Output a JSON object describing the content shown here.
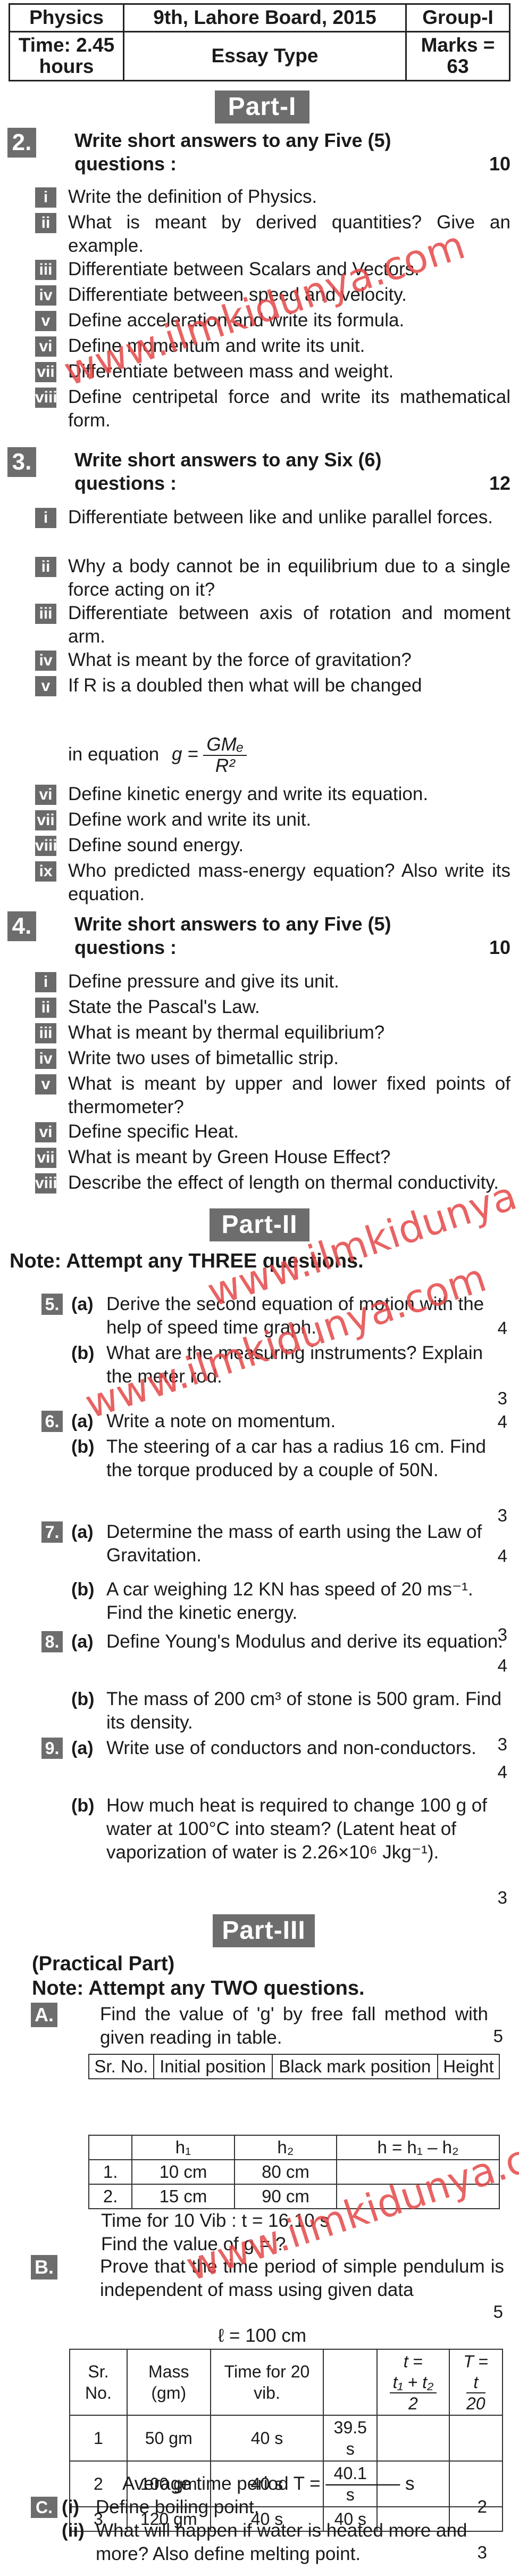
{
  "header": {
    "subject": "Physics",
    "board": "9th, Lahore Board, 2015",
    "group": "Group-I",
    "time": "Time: 2.45 hours",
    "type": "Essay Type",
    "marks": "Marks = 63"
  },
  "part1": {
    "title": "Part-I",
    "q2": {
      "num": "2.",
      "line1": "Write short answers to any Five (5)",
      "line2": "questions :",
      "marks": "10",
      "items": [
        {
          "tag": "i",
          "text": "Write the definition of Physics."
        },
        {
          "tag": "ii",
          "text": "What is meant by derived quantities? Give an example."
        },
        {
          "tag": "iii",
          "text": "Differentiate between Scalars and Vectors."
        },
        {
          "tag": "iv",
          "text": "Differentiate between speed and velocity."
        },
        {
          "tag": "v",
          "text": "Define acceleration and write its formula."
        },
        {
          "tag": "vi",
          "text": "Define momentum and write its unit."
        },
        {
          "tag": "vii",
          "text": "Differentiate between mass and weight."
        },
        {
          "tag": "viii",
          "text": "Define centripetal force and write its mathematical form."
        }
      ]
    },
    "q3": {
      "num": "3.",
      "line1": "Write short answers to any Six (6)",
      "line2": "questions :",
      "marks": "12",
      "items": [
        {
          "tag": "i",
          "text": "Differentiate between like and unlike parallel forces."
        },
        {
          "tag": "ii",
          "text": "Why a body cannot be in equilibrium due to a single force acting on it?"
        },
        {
          "tag": "iii",
          "text": "Differentiate between axis of rotation and moment arm."
        },
        {
          "tag": "iv",
          "text": "What is meant by the force of gravitation?"
        },
        {
          "tag": "v",
          "text": "If R is a doubled then what will be changed"
        },
        {
          "tag": "vi",
          "text": "Define kinetic energy and write its equation."
        },
        {
          "tag": "vii",
          "text": "Define work and write its unit."
        },
        {
          "tag": "viii",
          "text": "Define sound energy."
        },
        {
          "tag": "ix",
          "text": "Who predicted mass-energy equation? Also write its equation."
        }
      ],
      "equation_prefix": "in equation",
      "equation_lhs": "g =",
      "equation_num": "GMₑ",
      "equation_den": "R²"
    },
    "q4": {
      "num": "4.",
      "line1": "Write short answers to any Five (5)",
      "line2": "questions :",
      "marks": "10",
      "items": [
        {
          "tag": "i",
          "text": "Define pressure and give its unit."
        },
        {
          "tag": "ii",
          "text": "State the Pascal's Law."
        },
        {
          "tag": "iii",
          "text": "What is meant by thermal equilibrium?"
        },
        {
          "tag": "iv",
          "text": "Write two uses of bimetallic strip."
        },
        {
          "tag": "v",
          "text": "What is meant by upper and lower fixed points of thermometer?"
        },
        {
          "tag": "vi",
          "text": "Define specific Heat."
        },
        {
          "tag": "vii",
          "text": "What is meant by Green House Effect?"
        },
        {
          "tag": "viii",
          "text": "Describe the effect of length on thermal conductivity."
        }
      ]
    }
  },
  "part2": {
    "title": "Part-II",
    "note": "Note: Attempt any THREE questions.",
    "questions": [
      {
        "num": "5.",
        "a": "Derive the second equation of motion with the help of speed time graph.",
        "a_marks": "4",
        "b": "What are the measuring instruments? Explain the meter rod.",
        "b_marks": "3"
      },
      {
        "num": "6.",
        "a": "Write a note on momentum.",
        "a_marks": "4",
        "b": "The steering of a car has a radius 16 cm. Find the torque produced by a couple of 50N.",
        "b_marks": "3"
      },
      {
        "num": "7.",
        "a": "Determine the mass of earth using the Law of Gravitation.",
        "a_marks": "4",
        "b": "A car weighing 12 KN has speed of 20 ms⁻¹. Find the kinetic energy.",
        "b_marks": "3"
      },
      {
        "num": "8.",
        "a": "Define Young's Modulus and derive its equation.",
        "a_marks": "4",
        "b": "The mass of 200 cm³ of stone is 500 gram. Find its density.",
        "b_marks": "3"
      },
      {
        "num": "9.",
        "a": "Write use of conductors and non-conductors.",
        "a_marks": "4",
        "b": "How much heat is required to change 100 g of water at 100°C into steam? (Latent heat of vaporization of water is 2.26×10⁶ Jkg⁻¹).",
        "b_marks": "3"
      }
    ],
    "label_a": "(a)",
    "label_b": "(b)"
  },
  "part3": {
    "title": "Part-III",
    "subtitle": "(Practical Part)",
    "note": "Note: Attempt any TWO questions.",
    "A": {
      "tag": "A.",
      "text": "Find the value of 'g' by free fall method with given reading in table.",
      "marks": "5",
      "table1_headers": [
        "Sr. No.",
        "Initial position",
        "Black mark position",
        "Height"
      ],
      "table2_headers": [
        "",
        "h₁",
        "h₂",
        "h = h₁ – h₂"
      ],
      "table2_rows": [
        [
          "1.",
          "10 cm",
          "80 cm",
          ""
        ],
        [
          "2.",
          "15 cm",
          "90 cm",
          ""
        ]
      ],
      "time_line": "Time for 10 Vib :     t = 16.10 s",
      "find_line": "Find the value of g = ?"
    },
    "B": {
      "tag": "B.",
      "text": "Prove that the time period of simple pendulum is independent of mass using given data",
      "marks": "5",
      "length": "ℓ = 100 cm",
      "headers": [
        "Sr. No.",
        "Mass (gm)",
        "Time for 20 vib.",
        "",
        "",
        ""
      ],
      "rows": [
        [
          "1",
          "50 gm",
          "40 s",
          "39.5 s",
          "",
          ""
        ],
        [
          "2",
          "100 gm",
          "40 s",
          "40.1 s",
          "",
          ""
        ],
        [
          "3",
          "120 gm",
          "40 s",
          "40 s",
          "",
          ""
        ]
      ],
      "avg_line": "Average time period   T = ———— s"
    },
    "C": {
      "tag": "C.",
      "i_label": "(i)",
      "i_text": "Define boiling point.",
      "i_marks": "2",
      "ii_label": "(ii)",
      "ii_text": "What will happen if water is heated more and more? Also define melting point.",
      "ii_marks": "3"
    }
  },
  "watermark": "www.ilmkidunya.com"
}
